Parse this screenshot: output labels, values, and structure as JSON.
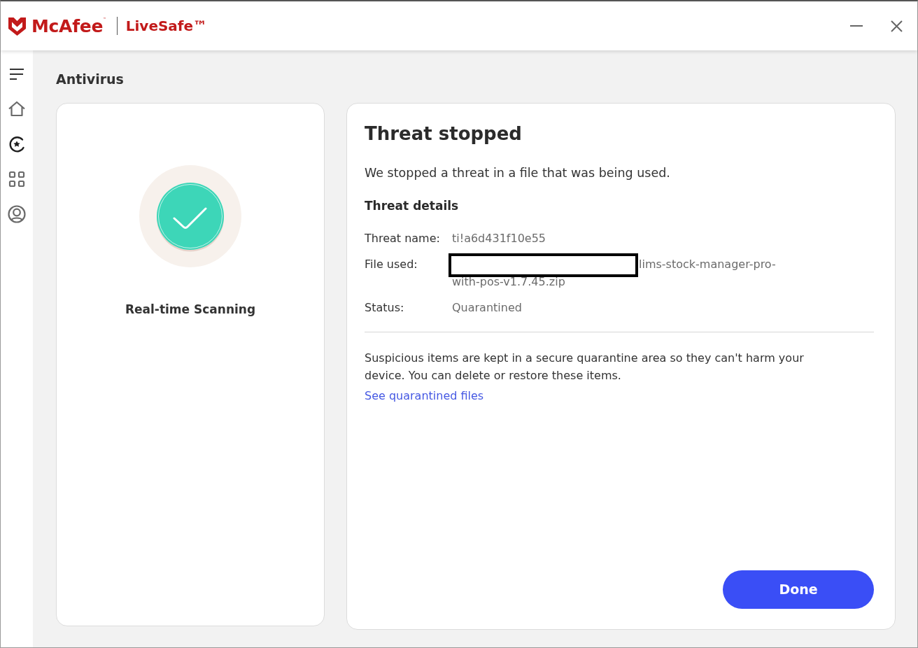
{
  "app": {
    "brand": "McAfee$^{™}$",
    "product": "LiveSafe™"
  },
  "sidebar": {
    "items": [
      {
        "selected": false
      },
      {
        "selected": true
      },
      {
        "selected": false
      },
      {
        "selected": false
      }
    ]
  },
  "page": {
    "title": "Antivirus"
  },
  "scan_panel": {
    "label": "Real-time Scanning"
  },
  "threat_panel": {
    "title": "Threat stopped",
    "message": "We stopped a threat in a file that was being used.",
    "details_heading": "Threat details",
    "details": [
      {
        "label": "Threat name:",
        "value": "ti!a6d431f10e55",
        "redacted": false
      },
      {
        "label": "File used:",
        "value": "lims-stock-manager-pro-with-pos-v1.7.45.zip",
        "redacted": true
      },
      {
        "label": "Status:",
        "value": "Quarantined",
        "redacted": false
      }
    ],
    "note": "Suspicious items are kept in a secure quarantine area so they can't harm your device. You can delete or restore these items.",
    "link": "See quarantined files",
    "button": "Done"
  }
}
